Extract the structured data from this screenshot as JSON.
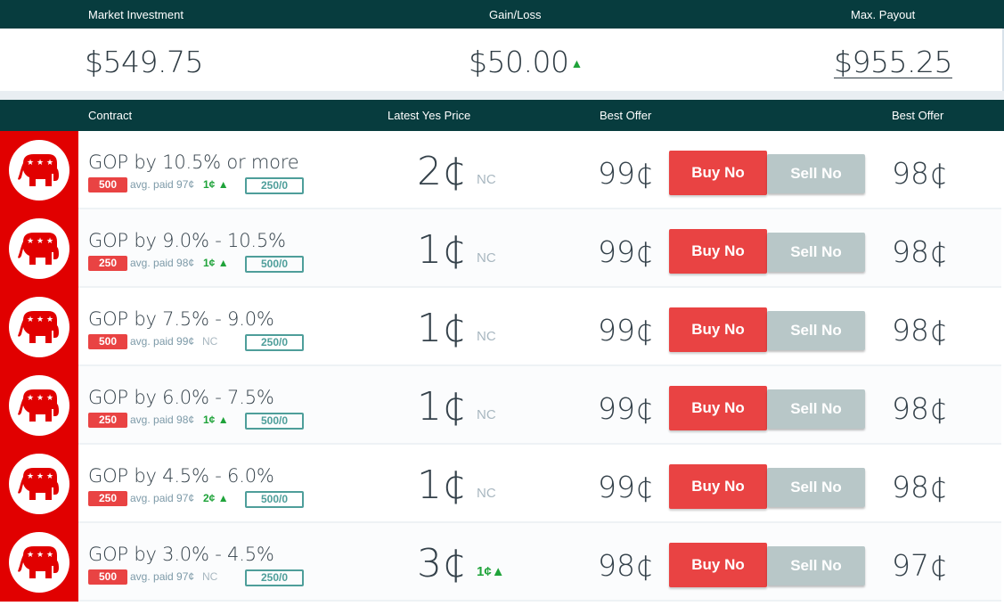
{
  "summary": {
    "headers": {
      "investment": "Market Investment",
      "gainloss": "Gain/Loss",
      "payout": "Max. Payout"
    },
    "investment": "$549.75",
    "gainloss": "$50.00",
    "payout": "$955.25",
    "gainloss_icon": "up-arrow-icon"
  },
  "columns": {
    "contract": "Contract",
    "yes_price": "Latest Yes Price",
    "best_offer_1": "Best Offer",
    "best_offer_2": "Best Offer"
  },
  "buttons": {
    "buy_no": "Buy No",
    "sell_no": "Sell No"
  },
  "colors": {
    "header_bg": "#073c3e",
    "party_red": "#e10000",
    "buy_red": "#e94343",
    "sell_gray": "#b8c7c8",
    "up_green": "#1fa33a"
  },
  "rows": [
    {
      "name": "GOP by 10.5% or more",
      "qty": "500",
      "avg": "avg. paid 97¢",
      "change": "1¢",
      "change_up": true,
      "ratio": "250/0",
      "yes": "2¢",
      "yes_change": "NC",
      "yes_up": false,
      "offer": "99¢",
      "offer2": "98¢"
    },
    {
      "name": "GOP by 9.0% - 10.5%",
      "qty": "250",
      "avg": "avg. paid 98¢",
      "change": "1¢",
      "change_up": true,
      "ratio": "500/0",
      "yes": "1¢",
      "yes_change": "NC",
      "yes_up": false,
      "offer": "99¢",
      "offer2": "98¢"
    },
    {
      "name": "GOP by 7.5% - 9.0%",
      "qty": "500",
      "avg": "avg. paid 99¢",
      "change": "NC",
      "change_up": false,
      "ratio": "250/0",
      "yes": "1¢",
      "yes_change": "NC",
      "yes_up": false,
      "offer": "99¢",
      "offer2": "98¢"
    },
    {
      "name": "GOP by 6.0% - 7.5%",
      "qty": "250",
      "avg": "avg. paid 98¢",
      "change": "1¢",
      "change_up": true,
      "ratio": "500/0",
      "yes": "1¢",
      "yes_change": "NC",
      "yes_up": false,
      "offer": "99¢",
      "offer2": "98¢"
    },
    {
      "name": "GOP by 4.5% - 6.0%",
      "qty": "250",
      "avg": "avg. paid 97¢",
      "change": "2¢",
      "change_up": true,
      "ratio": "500/0",
      "yes": "1¢",
      "yes_change": "NC",
      "yes_up": false,
      "offer": "99¢",
      "offer2": "98¢"
    },
    {
      "name": "GOP by 3.0% - 4.5%",
      "qty": "500",
      "avg": "avg. paid 97¢",
      "change": "NC",
      "change_up": false,
      "ratio": "250/0",
      "yes": "3¢",
      "yes_change": "1¢",
      "yes_up": true,
      "offer": "98¢",
      "offer2": "97¢"
    }
  ]
}
